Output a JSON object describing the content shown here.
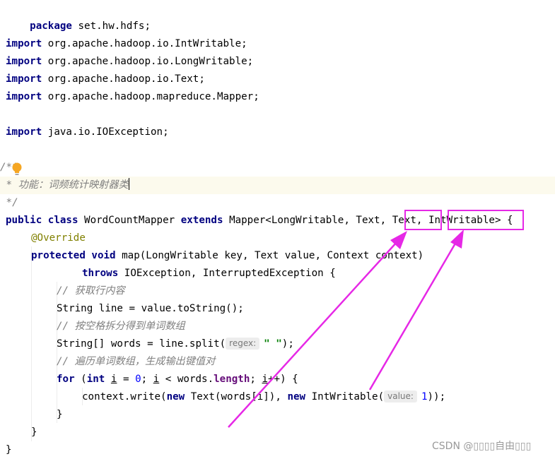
{
  "editor": {
    "package_kw": "package",
    "package_name": "set.hw.hdfs;",
    "import_kw": "import",
    "imports": [
      "org.apache.hadoop.io.IntWritable;",
      "org.apache.hadoop.io.LongWritable;",
      "org.apache.hadoop.io.Text;",
      "org.apache.hadoop.mapreduce.Mapper;"
    ],
    "import_io": "java.io.IOException;",
    "doc_open": "/**",
    "doc_body": " * 功能：词频统计映射器类",
    "doc_close": " */",
    "class_kw": "public class",
    "class_name": "WordCountMapper",
    "extends_kw": "extends",
    "mapper_prefix": "Mapper<LongWritable, Text,",
    "mapper_text": "Text",
    "mapper_intwritable": "IntWritable",
    "mapper_suffix": "> {",
    "annotation": "@Override",
    "method_kw": "protected void",
    "method_sig": "map(LongWritable key, Text value, Context context)",
    "throws_kw": "throws",
    "throws_list": "IOException, InterruptedException {",
    "comment_1": "// 获取行内容",
    "line_stmt": "String line = value.toString();",
    "comment_2": "// 按空格拆分得到单词数组",
    "split_prefix": "String[] words = line.split(",
    "split_hint": "regex:",
    "split_arg": "\" \"",
    "split_suffix": ");",
    "comment_3": "// 遍历单词数组，生成输出键值对",
    "for_kw": "for",
    "int_kw": "int",
    "for_var": "i",
    "for_assign": " = ",
    "for_zero": "0",
    "for_lt": " < words.",
    "for_length": "length",
    "for_incr": "++) {",
    "write_prefix": "context.write(",
    "new_kw": "new",
    "write_text": "Text(words[i]), ",
    "write_int": "IntWritable(",
    "value_hint": "value:",
    "write_one": "1",
    "write_suffix": "));",
    "close_brace": "}"
  },
  "watermark": "CSDN @▯▯▯▯自由▯▯▯",
  "colors": {
    "annotation_box": "#e628e6",
    "current_line": "#fcfaed"
  }
}
